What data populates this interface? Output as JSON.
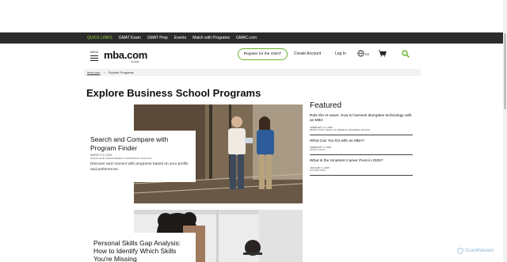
{
  "topnav": {
    "items": [
      "QUICK LINKS",
      "GMAT Exam",
      "GMAT Prep",
      "Events",
      "Match with Programs",
      "GMAC.com"
    ]
  },
  "header": {
    "menu_label": "MENU",
    "logo_text": "mba.com",
    "logo_sub": "by GMAC",
    "register_label": "Register for the GMAT",
    "create_account_label": "Create Account",
    "login_label": "Log In",
    "language_label": "EE"
  },
  "breadcrumb": {
    "home": "mba.com",
    "separator": ">",
    "current": "Explore Programs"
  },
  "page_title": "Explore Business School Programs",
  "hero_article": {
    "title": "Search and Compare with Program Finder",
    "date": "MARCH 10, 2022",
    "author": "GRADUATE MANAGEMENT ADMISSION COUNCIL",
    "description": "Discover and connect with programs based on your profile and preferences."
  },
  "second_article": {
    "title": "Personal Skills Gap Analysis: How to Identify Which Skills You're Missing"
  },
  "featured": {
    "heading": "Featured",
    "items": [
      {
        "title": "Ride the AI-wave: How to harness disruptive technology with an MBA",
        "date": "FEBRUARY 13, 2025",
        "author": "PETER TODD, DEAN OF IMPERIAL BUSINESS SCHOOL"
      },
      {
        "title": "What Can You Do with an MBA?",
        "date": "FEBRUARY 6, 2025",
        "author": "JASON LUCIO •"
      },
      {
        "title": "What Is the Smartest Career Pivot in 2025?",
        "date": "JANUARY 9, 2025",
        "author": "AUTHOR PAUL"
      }
    ]
  },
  "watermark": "ScanMalware",
  "colors": {
    "topbar_bg": "#2b2b2b",
    "accent_green": "#6ab42d",
    "quick_links": "#9bd33a"
  }
}
